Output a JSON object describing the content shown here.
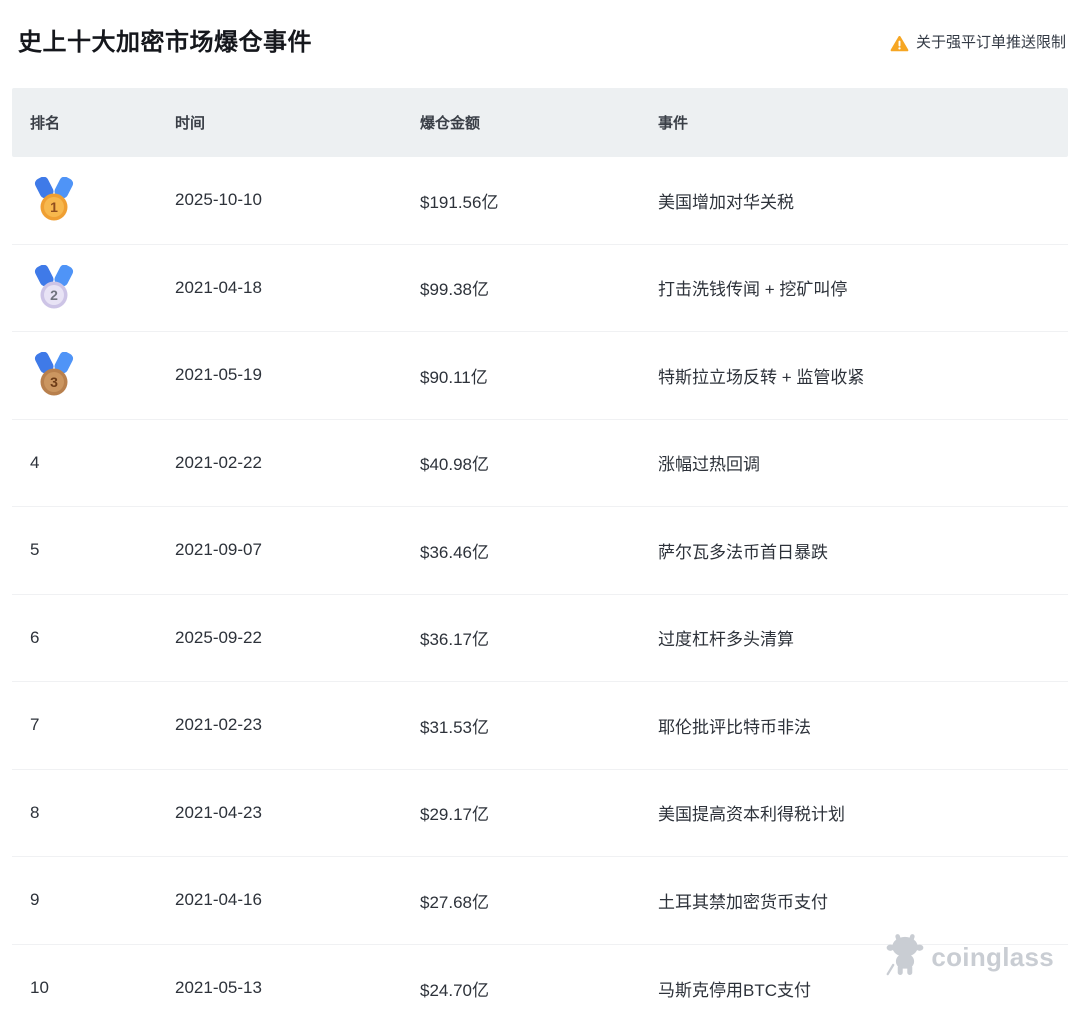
{
  "page": {
    "title": "史上十大加密市场爆仓事件",
    "notice": "关于强平订单推送限制"
  },
  "table": {
    "headers": {
      "rank": "排名",
      "time": "时间",
      "amount": "爆仓金额",
      "event": "事件"
    }
  },
  "rows": [
    {
      "rank": "1",
      "medal": "gold",
      "time": "2025-10-10",
      "amount": "$191.56亿",
      "event": "美国增加对华关税"
    },
    {
      "rank": "2",
      "medal": "silver",
      "time": "2021-04-18",
      "amount": "$99.38亿",
      "event": "打击洗钱传闻 + 挖矿叫停"
    },
    {
      "rank": "3",
      "medal": "bronze",
      "time": "2021-05-19",
      "amount": "$90.11亿",
      "event": "特斯拉立场反转 + 监管收紧"
    },
    {
      "rank": "4",
      "time": "2021-02-22",
      "amount": "$40.98亿",
      "event": "涨幅过热回调"
    },
    {
      "rank": "5",
      "time": "2021-09-07",
      "amount": "$36.46亿",
      "event": "萨尔瓦多法币首日暴跌"
    },
    {
      "rank": "6",
      "time": "2025-09-22",
      "amount": "$36.17亿",
      "event": "过度杠杆多头清算"
    },
    {
      "rank": "7",
      "time": "2021-02-23",
      "amount": "$31.53亿",
      "event": "耶伦批评比特币非法"
    },
    {
      "rank": "8",
      "time": "2021-04-23",
      "amount": "$29.17亿",
      "event": "美国提高资本利得税计划"
    },
    {
      "rank": "9",
      "time": "2021-04-16",
      "amount": "$27.68亿",
      "event": "土耳其禁加密货币支付"
    },
    {
      "rank": "10",
      "time": "2021-05-13",
      "amount": "$24.70亿",
      "event": "马斯克停用BTC支付"
    }
  ],
  "watermark": {
    "brand": "coinglass",
    "icon": "bull-icon"
  },
  "colors": {
    "warning": "#f6a623",
    "header_bg": "#edf0f2",
    "title_text": "#15171c",
    "body_text": "#2d323a",
    "medal_ribbon_left": "#3f7ae8",
    "medal_ribbon_right": "#4f94f7",
    "medal_gold_outer": "#ef9f33",
    "medal_gold_inner": "#f7b84e",
    "medal_gold_number": "#8f4d1e",
    "medal_silver_outer": "#cdc4e6",
    "medal_silver_inner": "#e8e3f5",
    "medal_silver_number": "#70737e",
    "medal_bronze_outer": "#b8804d",
    "medal_bronze_inner": "#cb9660",
    "medal_bronze_number": "#6d3c17",
    "watermark_gray": "#c9cdd3"
  }
}
